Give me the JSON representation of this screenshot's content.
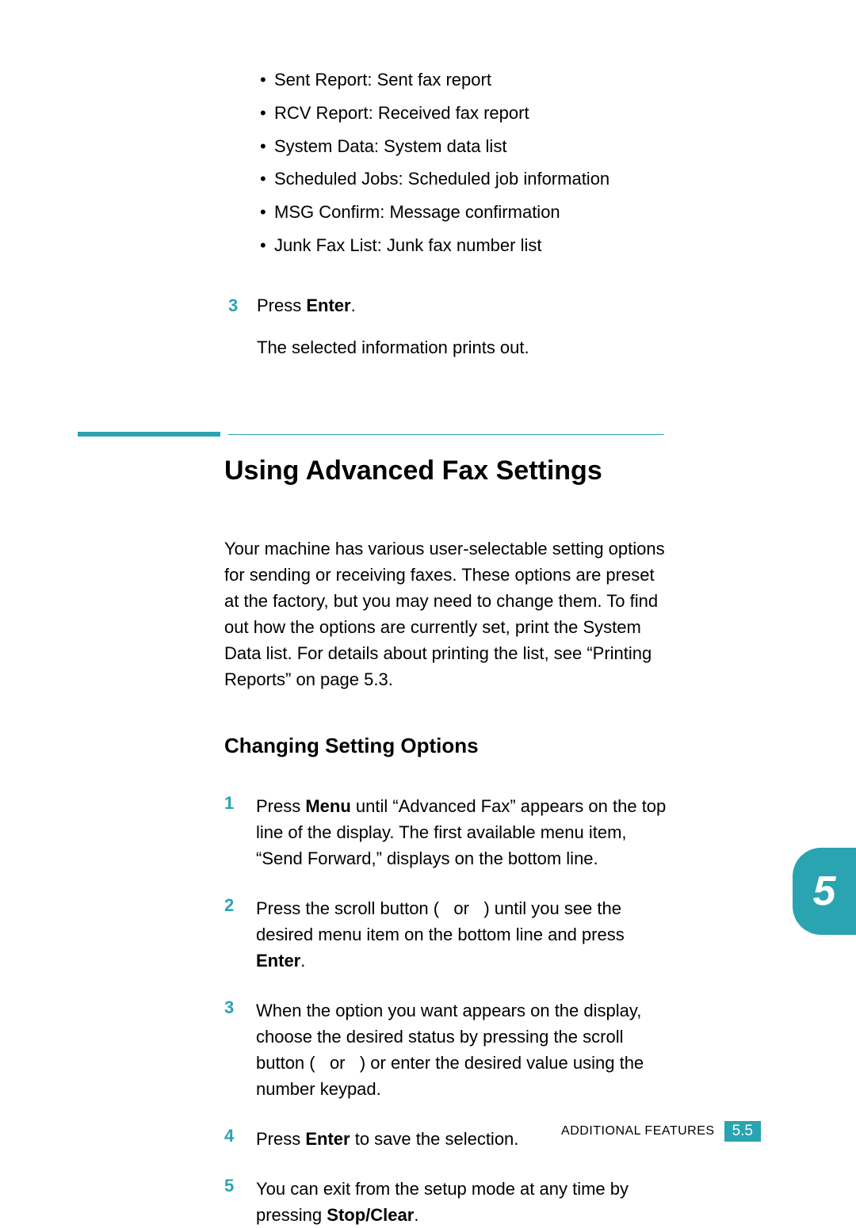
{
  "bullets": [
    "Sent Report: Sent fax report",
    "RCV Report: Received fax report",
    "System Data: System data list",
    "Scheduled Jobs: Scheduled job information",
    "MSG Confirm: Message confirmation",
    "Junk Fax List: Junk fax number list"
  ],
  "top_step": {
    "num": "3",
    "prefix": "Press ",
    "bold": "Enter",
    "suffix": ".",
    "follow": "The selected information prints out."
  },
  "section_title": "Using Advanced Fax Settings",
  "intro": "Your machine has various user-selectable setting options for sending or receiving faxes. These options are preset at the factory, but you may need to change them. To find out how the options are currently set, print the System Data list. For details about printing the list, see “Printing Reports” on page 5.3.",
  "subheading": "Changing Setting Options",
  "steps": [
    {
      "num": "1",
      "parts": [
        {
          "t": "Press "
        },
        {
          "t": "Menu",
          "b": true
        },
        {
          "t": " until “Advanced Fax” appears on the top line of the display. The first available menu item, “Send Forward,” displays on the bottom line."
        }
      ]
    },
    {
      "num": "2",
      "parts": [
        {
          "t": "Press the scroll button (   or   ) until you see the desired menu item on the bottom line and press "
        },
        {
          "t": "Enter",
          "b": true
        },
        {
          "t": "."
        }
      ]
    },
    {
      "num": "3",
      "parts": [
        {
          "t": "When the option you want appears on the display, choose the desired status by pressing the scroll button (   or   ) or enter the desired value using the number keypad."
        }
      ]
    },
    {
      "num": "4",
      "parts": [
        {
          "t": "Press "
        },
        {
          "t": "Enter",
          "b": true
        },
        {
          "t": " to save the selection."
        }
      ]
    },
    {
      "num": "5",
      "parts": [
        {
          "t": "You can exit from the setup mode at any time by pressing "
        },
        {
          "t": "Stop/Clear",
          "b": true
        },
        {
          "t": "."
        }
      ]
    }
  ],
  "chapter_tab": "5",
  "footer": {
    "label": "ADDITIONAL FEATURES",
    "page": "5.5"
  }
}
